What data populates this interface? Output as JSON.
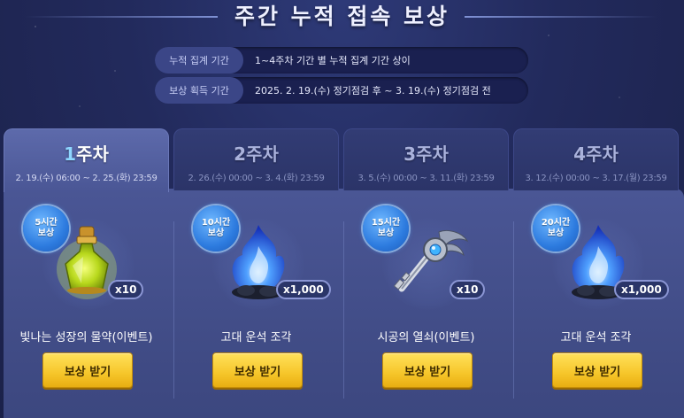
{
  "header": {
    "title": "주간 누적 접속 보상"
  },
  "info": [
    {
      "label": "누적 집계 기간",
      "value": "1~4주차 기간 별 누적 집계 기간 상이"
    },
    {
      "label": "보상 획득 기간",
      "value": "2025. 2. 19.(수) 정기점검 후 ~ 3. 19.(수) 정기점검 전"
    }
  ],
  "tabs": [
    {
      "num": "1",
      "suffix": "주차",
      "date": "2. 19.(수) 06:00 ~ 2. 25.(화) 23:59",
      "active": true
    },
    {
      "num": "2",
      "suffix": "주차",
      "date": "2. 26.(수) 00:00 ~ 3. 4.(화) 23:59",
      "active": false
    },
    {
      "num": "3",
      "suffix": "주차",
      "date": "3. 5.(수) 00:00 ~ 3. 11.(화) 23:59",
      "active": false
    },
    {
      "num": "4",
      "suffix": "주차",
      "date": "3. 12.(수) 00:00 ~ 3. 17.(월) 23:59",
      "active": false
    }
  ],
  "rewards": [
    {
      "badge_hours": "5시간",
      "badge_word": "보상",
      "icon": "potion-icon",
      "qty": "x10",
      "name": "빛나는 성장의 물약(이벤트)",
      "button": "보상 받기"
    },
    {
      "badge_hours": "10시간",
      "badge_word": "보상",
      "icon": "blue-flame-meteor-icon",
      "qty": "x1,000",
      "name": "고대 운석 조각",
      "button": "보상 받기"
    },
    {
      "badge_hours": "15시간",
      "badge_word": "보상",
      "icon": "key-icon",
      "qty": "x10",
      "name": "시공의 열쇠(이벤트)",
      "button": "보상 받기"
    },
    {
      "badge_hours": "20시간",
      "badge_word": "보상",
      "icon": "blue-flame-meteor-icon",
      "qty": "x1,000",
      "name": "고대 운석 조각",
      "button": "보상 받기"
    }
  ],
  "colors": {
    "accent_button": "#f6c62a",
    "active_tab_num": "#8ed6ff",
    "badge": "#2d7bdf"
  }
}
